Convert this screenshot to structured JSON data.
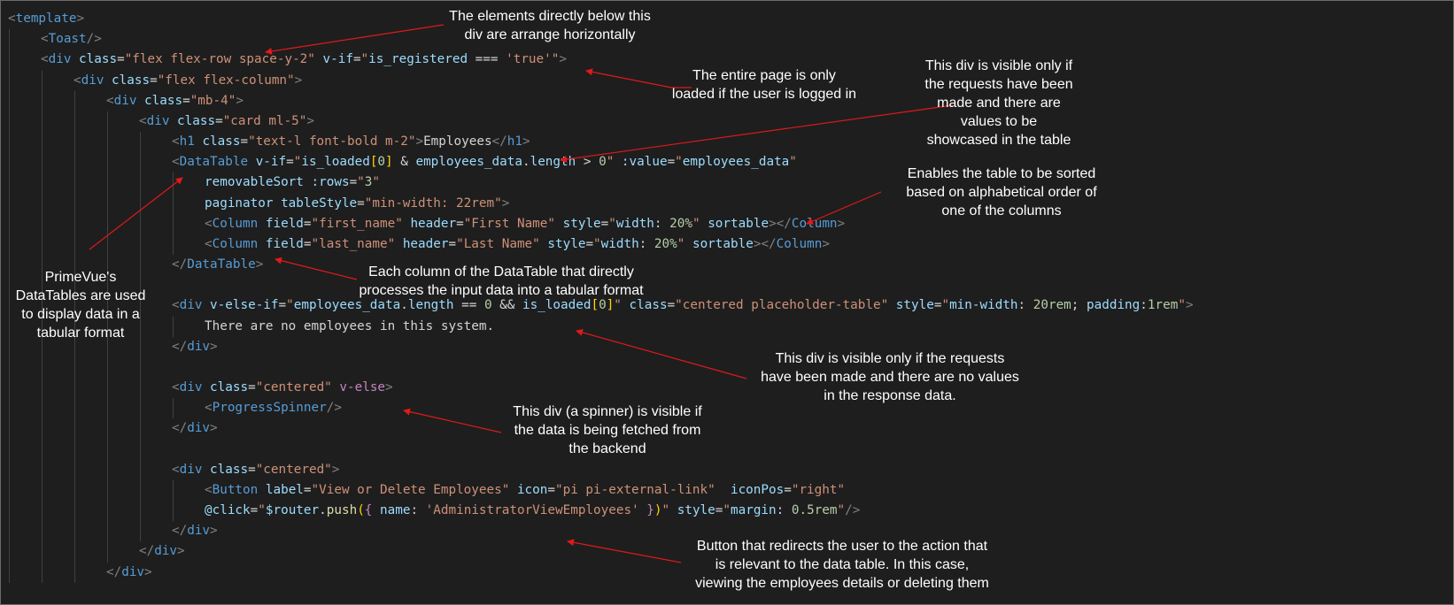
{
  "code": {
    "lines": [
      [
        [
          "tk-br",
          "<"
        ],
        [
          "tk-tag",
          "template"
        ],
        [
          "tk-br",
          ">"
        ]
      ],
      [
        [
          "tk-br",
          "<"
        ],
        [
          "tk-tag",
          "Toast"
        ],
        [
          "tk-br",
          "/>"
        ]
      ],
      [
        [
          "tk-br",
          "<"
        ],
        [
          "tk-tag",
          "div"
        ],
        [
          "tk-txt",
          " "
        ],
        [
          "tk-attr",
          "class"
        ],
        [
          "tk-txt",
          "="
        ],
        [
          "tk-str",
          "\"flex flex-row space-y-2\""
        ],
        [
          "tk-txt",
          " "
        ],
        [
          "tk-attr",
          "v-if"
        ],
        [
          "tk-txt",
          "="
        ],
        [
          "tk-str",
          "\""
        ],
        [
          "tk-attr",
          "is_registered"
        ],
        [
          "tk-txt",
          " === "
        ],
        [
          "tk-str",
          "'true'\""
        ],
        [
          "tk-br",
          ">"
        ]
      ],
      [
        [
          "tk-br",
          "<"
        ],
        [
          "tk-tag",
          "div"
        ],
        [
          "tk-txt",
          " "
        ],
        [
          "tk-attr",
          "class"
        ],
        [
          "tk-txt",
          "="
        ],
        [
          "tk-str",
          "\"flex flex-column\""
        ],
        [
          "tk-br",
          ">"
        ]
      ],
      [
        [
          "tk-br",
          "<"
        ],
        [
          "tk-tag",
          "div"
        ],
        [
          "tk-txt",
          " "
        ],
        [
          "tk-attr",
          "class"
        ],
        [
          "tk-txt",
          "="
        ],
        [
          "tk-str",
          "\"mb-4\""
        ],
        [
          "tk-br",
          ">"
        ]
      ],
      [
        [
          "tk-br",
          "<"
        ],
        [
          "tk-tag",
          "div"
        ],
        [
          "tk-txt",
          " "
        ],
        [
          "tk-attr",
          "class"
        ],
        [
          "tk-txt",
          "="
        ],
        [
          "tk-str",
          "\"card ml-5\""
        ],
        [
          "tk-br",
          ">"
        ]
      ],
      [
        [
          "tk-br",
          "<"
        ],
        [
          "tk-tag",
          "h1"
        ],
        [
          "tk-txt",
          " "
        ],
        [
          "tk-attr",
          "class"
        ],
        [
          "tk-txt",
          "="
        ],
        [
          "tk-str",
          "\"text-l font-bold m-2\""
        ],
        [
          "tk-br",
          ">"
        ],
        [
          "tk-txt",
          "Employees"
        ],
        [
          "tk-br",
          "</"
        ],
        [
          "tk-tag",
          "h1"
        ],
        [
          "tk-br",
          ">"
        ]
      ],
      [
        [
          "tk-br",
          "<"
        ],
        [
          "tk-tag",
          "DataTable"
        ],
        [
          "tk-txt",
          " "
        ],
        [
          "tk-attr",
          "v-if"
        ],
        [
          "tk-txt",
          "="
        ],
        [
          "tk-str",
          "\""
        ],
        [
          "tk-attr",
          "is_loaded"
        ],
        [
          "tk-y",
          "["
        ],
        [
          "tk-num",
          "0"
        ],
        [
          "tk-y",
          "]"
        ],
        [
          "tk-txt",
          " & "
        ],
        [
          "tk-attr",
          "employees_data"
        ],
        [
          "tk-txt",
          "."
        ],
        [
          "tk-attr",
          "length"
        ],
        [
          "tk-txt",
          " > "
        ],
        [
          "tk-num",
          "0"
        ],
        [
          "tk-str",
          "\""
        ],
        [
          "tk-txt",
          " "
        ],
        [
          "tk-attr",
          ":value"
        ],
        [
          "tk-txt",
          "="
        ],
        [
          "tk-str",
          "\""
        ],
        [
          "tk-attr",
          "employees_data"
        ],
        [
          "tk-str",
          "\""
        ]
      ],
      [
        [
          "tk-attr",
          "removableSort"
        ],
        [
          "tk-txt",
          " "
        ],
        [
          "tk-attr",
          ":rows"
        ],
        [
          "tk-txt",
          "="
        ],
        [
          "tk-str",
          "\""
        ],
        [
          "tk-num",
          "3"
        ],
        [
          "tk-str",
          "\""
        ]
      ],
      [
        [
          "tk-attr",
          "paginator"
        ],
        [
          "tk-txt",
          " "
        ],
        [
          "tk-attr",
          "tableStyle"
        ],
        [
          "tk-txt",
          "="
        ],
        [
          "tk-str",
          "\"min-width: 22rem\""
        ],
        [
          "tk-br",
          ">"
        ]
      ],
      [
        [
          "tk-br",
          "<"
        ],
        [
          "tk-tag",
          "Column"
        ],
        [
          "tk-txt",
          " "
        ],
        [
          "tk-attr",
          "field"
        ],
        [
          "tk-txt",
          "="
        ],
        [
          "tk-str",
          "\"first_name\""
        ],
        [
          "tk-txt",
          " "
        ],
        [
          "tk-attr",
          "header"
        ],
        [
          "tk-txt",
          "="
        ],
        [
          "tk-str",
          "\"First Name\""
        ],
        [
          "tk-txt",
          " "
        ],
        [
          "tk-attr",
          "style"
        ],
        [
          "tk-txt",
          "="
        ],
        [
          "tk-str",
          "\""
        ],
        [
          "tk-attr",
          "width"
        ],
        [
          "tk-txt",
          ": "
        ],
        [
          "tk-num",
          "20%"
        ],
        [
          "tk-str",
          "\""
        ],
        [
          "tk-txt",
          " "
        ],
        [
          "tk-attr",
          "sortable"
        ],
        [
          "tk-br",
          "></"
        ],
        [
          "tk-tag",
          "Column"
        ],
        [
          "tk-br",
          ">"
        ]
      ],
      [
        [
          "tk-br",
          "<"
        ],
        [
          "tk-tag",
          "Column"
        ],
        [
          "tk-txt",
          " "
        ],
        [
          "tk-attr",
          "field"
        ],
        [
          "tk-txt",
          "="
        ],
        [
          "tk-str",
          "\"last_name\""
        ],
        [
          "tk-txt",
          " "
        ],
        [
          "tk-attr",
          "header"
        ],
        [
          "tk-txt",
          "="
        ],
        [
          "tk-str",
          "\"Last Name\""
        ],
        [
          "tk-txt",
          " "
        ],
        [
          "tk-attr",
          "style"
        ],
        [
          "tk-txt",
          "="
        ],
        [
          "tk-str",
          "\""
        ],
        [
          "tk-attr",
          "width"
        ],
        [
          "tk-txt",
          ": "
        ],
        [
          "tk-num",
          "20%"
        ],
        [
          "tk-str",
          "\""
        ],
        [
          "tk-txt",
          " "
        ],
        [
          "tk-attr",
          "sortable"
        ],
        [
          "tk-br",
          "></"
        ],
        [
          "tk-tag",
          "Column"
        ],
        [
          "tk-br",
          ">"
        ]
      ],
      [
        [
          "tk-br",
          "</"
        ],
        [
          "tk-tag",
          "DataTable"
        ],
        [
          "tk-br",
          ">"
        ]
      ],
      [],
      [
        [
          "tk-br",
          "<"
        ],
        [
          "tk-tag",
          "div"
        ],
        [
          "tk-txt",
          " "
        ],
        [
          "tk-attr",
          "v-else-if"
        ],
        [
          "tk-txt",
          "="
        ],
        [
          "tk-str",
          "\""
        ],
        [
          "tk-attr",
          "employees_data"
        ],
        [
          "tk-txt",
          "."
        ],
        [
          "tk-attr",
          "length"
        ],
        [
          "tk-txt",
          " == "
        ],
        [
          "tk-num",
          "0"
        ],
        [
          "tk-txt",
          " && "
        ],
        [
          "tk-attr",
          "is_loaded"
        ],
        [
          "tk-y",
          "["
        ],
        [
          "tk-num",
          "0"
        ],
        [
          "tk-y",
          "]"
        ],
        [
          "tk-str",
          "\""
        ],
        [
          "tk-txt",
          " "
        ],
        [
          "tk-attr",
          "class"
        ],
        [
          "tk-txt",
          "="
        ],
        [
          "tk-str",
          "\"centered placeholder-table\""
        ],
        [
          "tk-txt",
          " "
        ],
        [
          "tk-attr",
          "style"
        ],
        [
          "tk-txt",
          "="
        ],
        [
          "tk-str",
          "\""
        ],
        [
          "tk-attr",
          "min-width"
        ],
        [
          "tk-txt",
          ": "
        ],
        [
          "tk-num",
          "20rem"
        ],
        [
          "tk-txt",
          "; "
        ],
        [
          "tk-attr",
          "padding"
        ],
        [
          "tk-txt",
          ":"
        ],
        [
          "tk-num",
          "1rem"
        ],
        [
          "tk-str",
          "\""
        ],
        [
          "tk-br",
          ">"
        ]
      ],
      [
        [
          "tk-txt",
          "There are no employees in this system."
        ]
      ],
      [
        [
          "tk-br",
          "</"
        ],
        [
          "tk-tag",
          "div"
        ],
        [
          "tk-br",
          ">"
        ]
      ],
      [],
      [
        [
          "tk-br",
          "<"
        ],
        [
          "tk-tag",
          "div"
        ],
        [
          "tk-txt",
          " "
        ],
        [
          "tk-attr",
          "class"
        ],
        [
          "tk-txt",
          "="
        ],
        [
          "tk-str",
          "\"centered\""
        ],
        [
          "tk-txt",
          " "
        ],
        [
          "tk-kw",
          "v-else"
        ],
        [
          "tk-br",
          ">"
        ]
      ],
      [
        [
          "tk-br",
          "<"
        ],
        [
          "tk-tag",
          "ProgressSpinner"
        ],
        [
          "tk-br",
          "/>"
        ]
      ],
      [
        [
          "tk-br",
          "</"
        ],
        [
          "tk-tag",
          "div"
        ],
        [
          "tk-br",
          ">"
        ]
      ],
      [],
      [
        [
          "tk-br",
          "<"
        ],
        [
          "tk-tag",
          "div"
        ],
        [
          "tk-txt",
          " "
        ],
        [
          "tk-attr",
          "class"
        ],
        [
          "tk-txt",
          "="
        ],
        [
          "tk-str",
          "\"centered\""
        ],
        [
          "tk-br",
          ">"
        ]
      ],
      [
        [
          "tk-br",
          "<"
        ],
        [
          "tk-tag",
          "Button"
        ],
        [
          "tk-txt",
          " "
        ],
        [
          "tk-attr",
          "label"
        ],
        [
          "tk-txt",
          "="
        ],
        [
          "tk-str",
          "\"View or Delete Employees\""
        ],
        [
          "tk-txt",
          " "
        ],
        [
          "tk-attr",
          "icon"
        ],
        [
          "tk-txt",
          "="
        ],
        [
          "tk-str",
          "\"pi pi-external-link\""
        ],
        [
          "tk-txt",
          "  "
        ],
        [
          "tk-attr",
          "iconPos"
        ],
        [
          "tk-txt",
          "="
        ],
        [
          "tk-str",
          "\"right\""
        ]
      ],
      [
        [
          "tk-attr",
          "@click"
        ],
        [
          "tk-txt",
          "="
        ],
        [
          "tk-str",
          "\""
        ],
        [
          "tk-attr",
          "$router"
        ],
        [
          "tk-txt",
          "."
        ],
        [
          "tk-fn",
          "push"
        ],
        [
          "tk-y",
          "("
        ],
        [
          "tk-kw",
          "{"
        ],
        [
          "tk-txt",
          " "
        ],
        [
          "tk-attr",
          "name"
        ],
        [
          "tk-txt",
          ": "
        ],
        [
          "tk-str",
          "'AdministratorViewEmployees'"
        ],
        [
          "tk-txt",
          " "
        ],
        [
          "tk-kw",
          "}"
        ],
        [
          "tk-y",
          ")"
        ],
        [
          "tk-str",
          "\""
        ],
        [
          "tk-txt",
          " "
        ],
        [
          "tk-attr",
          "style"
        ],
        [
          "tk-txt",
          "="
        ],
        [
          "tk-str",
          "\""
        ],
        [
          "tk-attr",
          "margin"
        ],
        [
          "tk-txt",
          ": "
        ],
        [
          "tk-num",
          "0.5rem"
        ],
        [
          "tk-str",
          "\""
        ],
        [
          "tk-br",
          "/>"
        ]
      ],
      [
        [
          "tk-br",
          "</"
        ],
        [
          "tk-tag",
          "div"
        ],
        [
          "tk-br",
          ">"
        ]
      ],
      [
        [
          "tk-br",
          "</"
        ],
        [
          "tk-tag",
          "div"
        ],
        [
          "tk-br",
          ">"
        ]
      ],
      [
        [
          "tk-br",
          "</"
        ],
        [
          "tk-tag",
          "div"
        ],
        [
          "tk-br",
          ">"
        ]
      ]
    ]
  },
  "annotations": [
    "The elements directly below this\ndiv are arrange horizontally",
    "The entire page is only\nloaded if the user is logged in",
    "This div is visible only if\nthe requests have been\nmade and there are\nvalues to be\nshowcased in the table",
    "Enables the table to be sorted\nbased on alphabetical order of\none of the columns",
    "PrimeVue's\nDataTables are used\nto display data in a\ntabular format",
    "Each column of the DataTable that directly\nprocesses the input data into a tabular format",
    "This div is visible only if the requests\nhave been made and there are no values\nin the response data.",
    "This div (a spinner) is visible if\nthe data is being fetched from\nthe backend",
    "Button that redirects the user to the action that\nis relevant to the data table. In this case,\nviewing the employees details or deleting them"
  ],
  "colors": {
    "editor_background": "#1e1e1e",
    "annotation_text": "#ffffff",
    "annotation_arrow": "#e0191b",
    "indent_guide": "#404040"
  }
}
